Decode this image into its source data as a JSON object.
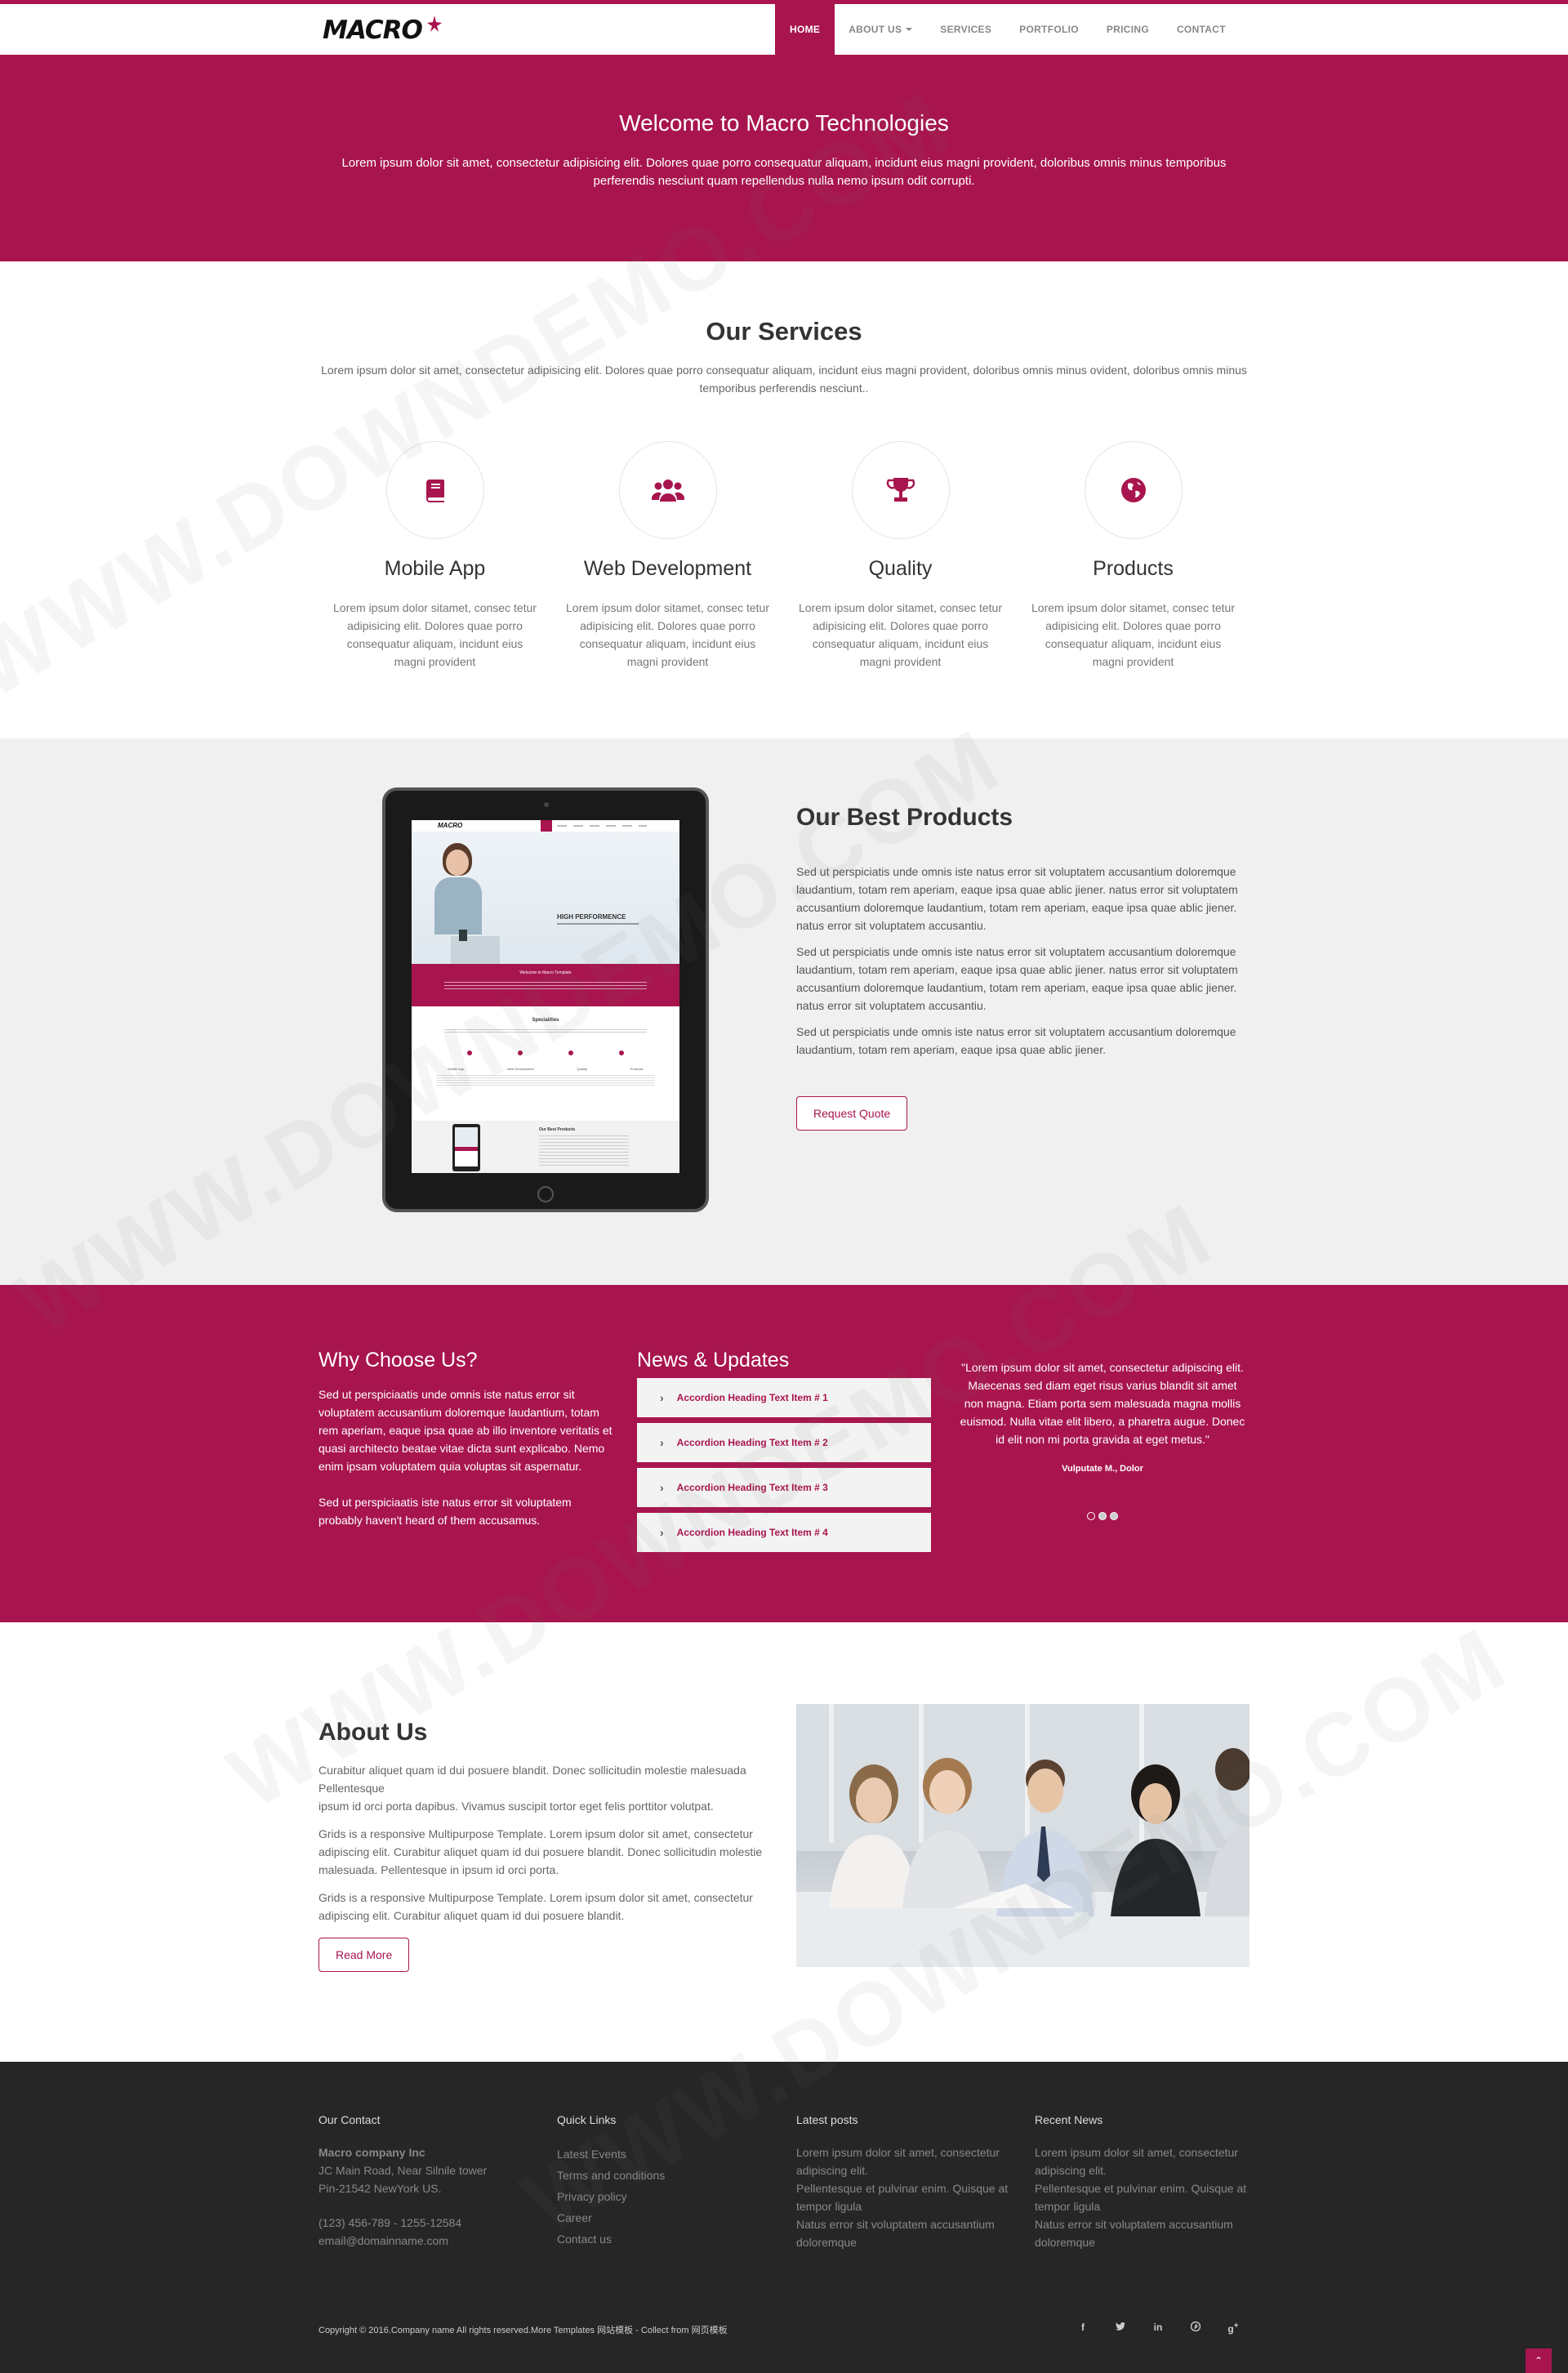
{
  "brand": {
    "logo": "MACRO",
    "accent": "#a8154e"
  },
  "nav": {
    "items": [
      {
        "label": "HOME",
        "active": true
      },
      {
        "label": "ABOUT US",
        "dropdown": true
      },
      {
        "label": "SERVICES"
      },
      {
        "label": "PORTFOLIO"
      },
      {
        "label": "PRICING"
      },
      {
        "label": "CONTACT"
      }
    ]
  },
  "hero": {
    "title": "Welcome to Macro Technologies",
    "text": "Lorem ipsum dolor sit amet, consectetur adipisicing elit. Dolores quae porro consequatur aliquam, incidunt eius magni provident, doloribus omnis minus temporibus perferendis nesciunt quam repellendus nulla nemo ipsum odit corrupti."
  },
  "services": {
    "title": "Our Services",
    "lead": "Lorem ipsum dolor sit amet, consectetur adipisicing elit. Dolores quae porro consequatur aliquam, incidunt eius magni provident, doloribus omnis minus ovident, doloribus omnis minus temporibus perferendis nesciunt..",
    "items": [
      {
        "icon": "book-icon",
        "title": "Mobile App",
        "text": "Lorem ipsum dolor sitamet, consec tetur adipisicing elit. Dolores quae porro consequatur aliquam, incidunt eius magni provident"
      },
      {
        "icon": "users-icon",
        "title": "Web Development",
        "text": "Lorem ipsum dolor sitamet, consec tetur adipisicing elit. Dolores quae porro consequatur aliquam, incidunt eius magni provident"
      },
      {
        "icon": "trophy-icon",
        "title": "Quality",
        "text": "Lorem ipsum dolor sitamet, consec tetur adipisicing elit. Dolores quae porro consequatur aliquam, incidunt eius magni provident"
      },
      {
        "icon": "globe-icon",
        "title": "Products",
        "text": "Lorem ipsum dolor sitamet, consec tetur adipisicing elit. Dolores quae porro consequatur aliquam, incidunt eius magni provident"
      }
    ]
  },
  "products": {
    "title": "Our Best Products",
    "paragraphs": [
      "Sed ut perspiciatis unde omnis iste natus error sit voluptatem accusantium doloremque laudantium, totam rem aperiam, eaque ipsa quae ablic jiener. natus error sit voluptatem accusantium doloremque laudantium, totam rem aperiam, eaque ipsa quae ablic jiener. natus error sit voluptatem accusantiu.",
      "Sed ut perspiciatis unde omnis iste natus error sit voluptatem accusantium doloremque laudantium, totam rem aperiam, eaque ipsa quae ablic jiener. natus error sit voluptatem accusantium doloremque laudantium, totam rem aperiam, eaque ipsa quae ablic jiener. natus error sit voluptatem accusantiu.",
      "Sed ut perspiciatis unde omnis iste natus error sit voluptatem accusantium doloremque laudantium, totam rem aperiam, eaque ipsa quae ablic jiener."
    ],
    "button": "Request Quote",
    "screen": {
      "logo": "MACRO",
      "banner": "HIGH PERFORMENCE",
      "welcome": "Welcome to Macro Template",
      "services_heading": "Specialities",
      "service_labels": [
        "Mobile App",
        "Web Development",
        "Quality",
        "Products"
      ],
      "products_heading": "Our Best Products"
    }
  },
  "why": {
    "title": "Why Choose Us?",
    "p1": "Sed ut perspiciaatis unde omnis iste natus error sit voluptatem accusantium doloremque laudantium, totam rem aperiam, eaque ipsa quae ab illo inventore veritatis et quasi architecto beatae vitae dicta sunt explicabo. Nemo enim ipsam voluptatem quia voluptas sit aspernatur.",
    "p2": "Sed ut perspiciaatis iste natus error sit voluptatem probably haven't heard of them accusamus."
  },
  "news": {
    "title": "News & Updates",
    "items": [
      "Accordion Heading Text Item # 1",
      "Accordion Heading Text Item # 2",
      "Accordion Heading Text Item # 3",
      "Accordion Heading Text Item # 4"
    ]
  },
  "testimonial": {
    "quote": "\"Lorem ipsum dolor sit amet, consectetur adipiscing elit. Maecenas sed diam eget risus varius blandit sit amet non magna. Etiam porta sem malesuada magna mollis euismod. Nulla vitae elit libero, a pharetra augue. Donec id elit non mi porta gravida at eget metus.\"",
    "author": "Vulputate M., Dolor"
  },
  "about": {
    "title": "About Us",
    "p1a": "Curabitur aliquet quam id dui posuere blandit. Donec sollicitudin molestie malesuada Pellentesque",
    "p1b": "ipsum id orci porta dapibus. Vivamus suscipit tortor eget felis porttitor volutpat.",
    "p2": "Grids is a responsive Multipurpose Template. Lorem ipsum dolor sit amet, consectetur adipiscing elit. Curabitur aliquet quam id dui posuere blandit. Donec sollicitudin molestie malesuada. Pellentesque in ipsum id orci porta.",
    "p3": "Grids is a responsive Multipurpose Template. Lorem ipsum dolor sit amet, consectetur adipiscing elit. Curabitur aliquet quam id dui posuere blandit.",
    "button": "Read More"
  },
  "footer": {
    "contact": {
      "title": "Our Contact",
      "company": "Macro company Inc",
      "address1": "JC Main Road, Near Silnile tower",
      "address2": "Pin-21542 NewYork US.",
      "phone": "(123) 456-789 - 1255-12584",
      "email": "email@domainname.com"
    },
    "quick_links": {
      "title": "Quick Links",
      "items": [
        "Latest Events",
        "Terms and conditions",
        "Privacy policy",
        "Career",
        "Contact us"
      ]
    },
    "latest_posts": {
      "title": "Latest posts",
      "items": [
        "Lorem ipsum dolor sit amet, consectetur adipiscing elit.",
        "Pellentesque et pulvinar enim. Quisque at tempor ligula",
        "Natus error sit voluptatem accusantium doloremque"
      ]
    },
    "recent_news": {
      "title": "Recent News",
      "items": [
        "Lorem ipsum dolor sit amet, consectetur adipiscing elit.",
        "Pellentesque et pulvinar enim. Quisque at tempor ligula",
        "Natus error sit voluptatem accusantium doloremque"
      ]
    },
    "copyright": "Copyright © 2016.Company name All rights reserved.More Templates 网站模板 - Collect from 网页模板",
    "social": [
      "facebook-icon",
      "twitter-icon",
      "linkedin-icon",
      "pinterest-icon",
      "google-plus-icon"
    ]
  },
  "watermark": "WWW.DOWNDEMO.COM"
}
